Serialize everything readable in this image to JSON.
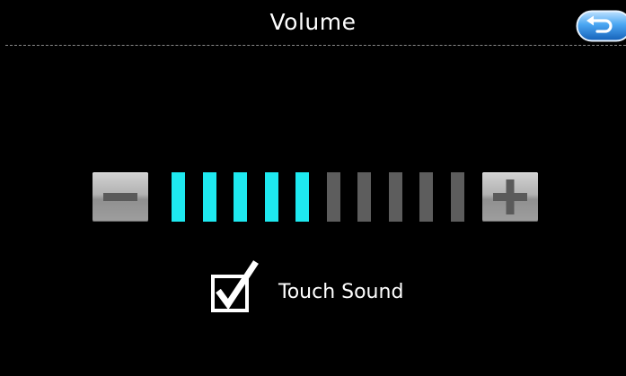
{
  "header": {
    "title": "Volume",
    "back_icon": "back-arrow-icon"
  },
  "volume": {
    "level": 5,
    "max_level": 10,
    "active_color": "#1ee9f0",
    "inactive_color": "#5d5d5d",
    "minus_icon": "minus-icon",
    "plus_icon": "plus-icon"
  },
  "touch_sound": {
    "label": "Touch Sound",
    "checked": true
  }
}
